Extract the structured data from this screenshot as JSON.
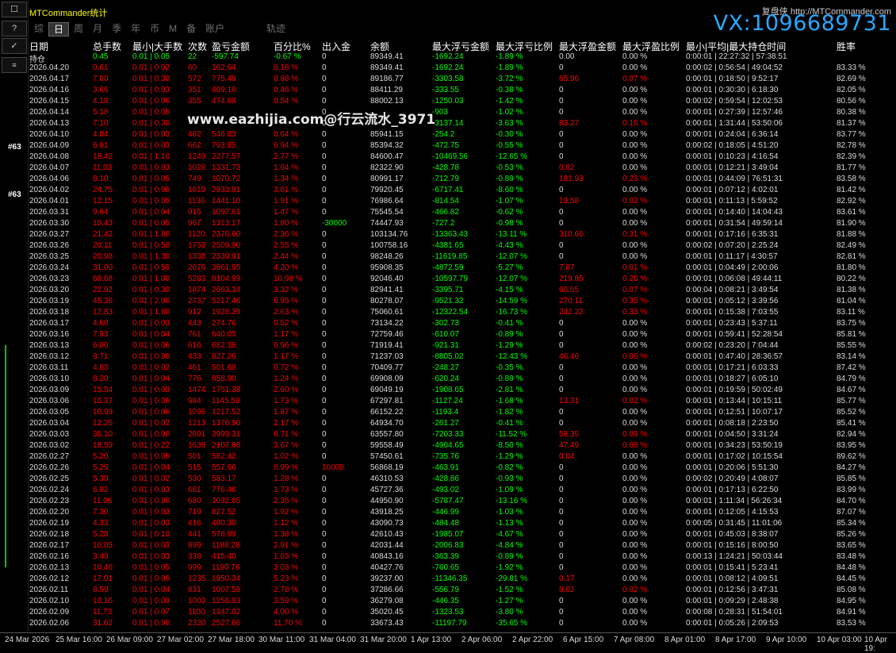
{
  "app": {
    "title": "MTCommander统计",
    "brand": "复盘侠 http://MTCommander.com",
    "vx": "VX:1096689731"
  },
  "watermark": "www.eazhijia.com@行云流水_3971",
  "tabs": [
    "综",
    "日",
    "周",
    "月",
    "季",
    "年",
    "币",
    "M",
    "备",
    "账户"
  ],
  "active_tab": "日",
  "track_tab": "轨迹",
  "left_toolbar": {
    "items": [
      "☐",
      "?",
      "✓"
    ],
    "marker": "#63"
  },
  "headers": [
    "日期",
    "总手数",
    "最小|大手数",
    "次数",
    "盈亏金额",
    "百分比%",
    "出入金",
    "余额",
    "最大浮亏金额",
    "最大浮亏比例",
    "最大浮盈金额",
    "最大浮盈比例",
    "最小|平均|最大持仓时间",
    "胜率"
  ],
  "holding": {
    "date": "持仓",
    "lots": "0.45",
    "minmax": "0.01 | 0.05",
    "count": "22",
    "pnl": "-597.74",
    "pct": "-0.67 %",
    "io": "0",
    "balance": "89349.41",
    "maxloss": "-1692.24",
    "maxlosspct": "-1.89 %",
    "maxprofit": "0.00",
    "maxprofitpct": "0.00 %",
    "time": "0:00:01 | 22:27:32 | 57:38:51",
    "win": ""
  },
  "rows": [
    [
      "2026.04.20",
      "0.61",
      "0.01 | 0.02",
      "60",
      "162.64",
      "0.18 %",
      "0",
      "89349.41",
      "-1692.24",
      "-1.89 %",
      "0",
      "0.00 %",
      "0:00:02 | 0:56:54 | 49:04:52",
      "83.33 %"
    ],
    [
      "2026.04.17",
      "7.00",
      "0.01 | 0.30",
      "572",
      "775.48",
      "0.88 %",
      "0",
      "89186.77",
      "-3303.58",
      "-3.72 %",
      "65.96",
      "0.07 %",
      "0:00:01 | 0:18:50 | 9:52:17",
      "82.69 %"
    ],
    [
      "2026.04.16",
      "3.66",
      "0.01 | 0.03",
      "351",
      "409.16",
      "0.46 %",
      "0",
      "88411.29",
      "-333.55",
      "-0.38 %",
      "0",
      "0.00 %",
      "0:00:01 | 0:30:30 | 6:18:30",
      "82.05 %"
    ],
    [
      "2026.04.15",
      "4.18",
      "0.01 | 0.06",
      "355",
      "474.68",
      "0.54 %",
      "0",
      "88002.13",
      "-1250.03",
      "-1.42 %",
      "0",
      "0.00 %",
      "0:00:02 | 0:59:54 | 12:02:53",
      "80.56 %"
    ],
    [
      "2026.04.14",
      "5.18",
      "0.01 | 0.05",
      "",
      "",
      "",
      "0",
      "",
      "-903",
      "-1.02 %",
      "0",
      "0.00 %",
      "0:00:01 | 0:27:39 | 12:57:46",
      "80.38 %"
    ],
    [
      "2026.04.13",
      "7.10",
      "0.01 | 0.30",
      "",
      "",
      "",
      "0",
      "",
      "-3137.14",
      "-3.63 %",
      "83.27",
      "0.10 %",
      "0:00:01 | 1:31:44 | 53:50:06",
      "81.37 %"
    ],
    [
      "2026.04.10",
      "4.84",
      "0.01 | 0.03",
      "462",
      "546.83",
      "0.64 %",
      "0",
      "85941.15",
      "-254.2",
      "-0.30 %",
      "0",
      "0.00 %",
      "0:00:01 | 0:24:04 | 6:36:14",
      "83.77 %"
    ],
    [
      "2026.04.09",
      "6.91",
      "0.01 | 0.03",
      "662",
      "793.85",
      "0.94 %",
      "0",
      "85394.32",
      "-472.75",
      "-0.55 %",
      "0",
      "0.00 %",
      "0:00:02 | 0:18:05 | 4:51:20",
      "82.78 %"
    ],
    [
      "2026.04.08",
      "18.42",
      "0.01 | 1.10",
      "1249",
      "2277.57",
      "2.77 %",
      "0",
      "84600.47",
      "-10469.56",
      "-12.65 %",
      "0",
      "0.00 %",
      "0:00:01 | 0:10:23 | 4:16:54",
      "82.39 %"
    ],
    [
      "2026.04.07",
      "11.03",
      "0.01 | 0.03",
      "1026",
      "1331.73",
      "1.64 %",
      "0",
      "82322.90",
      "-428.78",
      "-0.53 %",
      "0.82",
      "0.00 %",
      "0:00:01 | 0:12:21 | 3:49:04",
      "81.77 %"
    ],
    [
      "2026.04.06",
      "8.10",
      "0.01 | 0.05",
      "749",
      "1070.72",
      "1.34 %",
      "0",
      "80991.17",
      "-712.79",
      "-0.89 %",
      "181.93",
      "0.23 %",
      "0:00:01 | 0:44:09 | 76:51:31",
      "83.58 %"
    ],
    [
      "2026.04.02",
      "24.75",
      "0.01 | 0.90",
      "1819",
      "2933.81",
      "3.81 %",
      "0",
      "79920.45",
      "-6717.41",
      "-8.60 %",
      "0",
      "0.00 %",
      "0:00:01 | 0:07:12 | 4:02:01",
      "81.42 %"
    ],
    [
      "2026.04.01",
      "12.15",
      "0.01 | 0.05",
      "1136",
      "1441.10",
      "1.91 %",
      "0",
      "76986.64",
      "-814.54",
      "-1.07 %",
      "19.58",
      "0.03 %",
      "0:00:01 | 0:11:13 | 5:59:52",
      "82.92 %"
    ],
    [
      "2026.03.31",
      "9.64",
      "0.01 | 0.04",
      "915",
      "1097.61",
      "1.47 %",
      "0",
      "75545.54",
      "-466.82",
      "-0.62 %",
      "0",
      "0.00 %",
      "0:00:01 | 0:14:40 | 14:04:43",
      "83.61 %"
    ],
    [
      "2026.03.30",
      "10.43",
      "0.01 | 0.05",
      "967",
      "1313.17",
      "1.80 %",
      "-30000",
      "74447.93",
      "-727.2",
      "-0.98 %",
      "0",
      "0.00 %",
      "0:00:01 | 0:31:54 | 49:59:14",
      "81.90 %"
    ],
    [
      "2026.03.27",
      "21.42",
      "0.01 | 1.80",
      "1120",
      "2376.60",
      "2.36 %",
      "0",
      "103134.76",
      "-13363.43",
      "-13.11 %",
      "310.66",
      "0.31 %",
      "0:00:01 | 0:17:16 | 6:35:31",
      "81.88 %"
    ],
    [
      "2026.03.26",
      "20.11",
      "0.01 | 0.50",
      "1759",
      "2509.90",
      "2.55 %",
      "0",
      "100758.16",
      "-4381.65",
      "-4.43 %",
      "0",
      "0.00 %",
      "0:00:02 | 0:07:20 | 2:25:24",
      "82.49 %"
    ],
    [
      "2026.03.25",
      "20.98",
      "0.01 | 1.30",
      "1338",
      "2339.91",
      "2.44 %",
      "0",
      "98248.26",
      "-11619.85",
      "-12.07 %",
      "0",
      "0.00 %",
      "0:00:01 | 0:11:17 | 4:30:57",
      "82.81 %"
    ],
    [
      "2026.03.24",
      "31.00",
      "0.01 | 0.50",
      "2676",
      "3861.95",
      "4.20 %",
      "0",
      "95908.35",
      "-4872.59",
      "-5.27 %",
      "7.87",
      "0.01 %",
      "0:00:01 | 0:04:49 | 2:00:06",
      "81.80 %"
    ],
    [
      "2026.03.23",
      "68.68",
      "0.01 | 1.00",
      "5283",
      "8104.99",
      "10.98 %",
      "0",
      "92046.40",
      "-10597.79",
      "-12.07 %",
      "219.85",
      "0.26 %",
      "0:00:01 | 0:06:08 | 49:44:11",
      "80.22 %"
    ],
    [
      "2026.03.20",
      "22.92",
      "0.01 | 0.30",
      "1874",
      "2663.34",
      "3.32 %",
      "0",
      "82941.41",
      "-3395.71",
      "-4.15 %",
      "60.55",
      "0.07 %",
      "0:00:04 | 0:08:21 | 3:49:54",
      "81.38 %"
    ],
    [
      "2026.03.19",
      "45.36",
      "0.01 | 2.00",
      "2737",
      "5217.46",
      "6.95 %",
      "0",
      "80278.07",
      "-9521.32",
      "-14.59 %",
      "270.11",
      "0.35 %",
      "0:00:01 | 0:05:12 | 3:39:56",
      "81.04 %"
    ],
    [
      "2026.03.18",
      "17.83",
      "0.01 | 1.80",
      "912",
      "1926.39",
      "2.63 %",
      "0",
      "75060.61",
      "-12322.54",
      "-16.73 %",
      "242.22",
      "0.33 %",
      "0:00:01 | 0:15:38 | 7:03:55",
      "83.11 %"
    ],
    [
      "2026.03.17",
      "4.60",
      "0.01 | 0.03",
      "443",
      "274.76",
      "0.52 %",
      "0",
      "73134.22",
      "-302.73",
      "-0.41 %",
      "0",
      "0.00 %",
      "0:00:01 | 0:23:43 | 5:37:11",
      "83.75 %"
    ],
    [
      "2026.03.16",
      "7.93",
      "0.01 | 0.04",
      "761",
      "640.05",
      "1.17 %",
      "0",
      "72759.46",
      "-610.07",
      "-0.89 %",
      "0",
      "0.00 %",
      "0:00:01 | 0:59:41 | 52:28:54",
      "85.81 %"
    ],
    [
      "2026.03.13",
      "6.80",
      "0.01 | 0.06",
      "616",
      "682.38",
      "0.96 %",
      "0",
      "71919.41",
      "-921.31",
      "-1.29 %",
      "0",
      "0.00 %",
      "0:00:02 | 0:23:20 | 7:04:44",
      "85.55 %"
    ],
    [
      "2026.03.12",
      "8.71",
      "0.01 | 0.90",
      "433",
      "827.26",
      "1.17 %",
      "0",
      "71237.03",
      "-8805.02",
      "-12.43 %",
      "40.46",
      "0.06 %",
      "0:00:01 | 0:47:40 | 28:36:57",
      "83.14 %"
    ],
    [
      "2026.03.11",
      "4.83",
      "0.01 | 0.02",
      "461",
      "501.68",
      "0.72 %",
      "0",
      "70409.77",
      "-248.27",
      "-0.35 %",
      "0",
      "0.00 %",
      "0:00:01 | 0:17:21 | 6:03:33",
      "87.42 %"
    ],
    [
      "2026.03.10",
      "8.20",
      "0.01 | 0.04",
      "776",
      "858.90",
      "1.24 %",
      "0",
      "69908.09",
      "-620.24",
      "-0.89 %",
      "0",
      "0.00 %",
      "0:00:01 | 0:18:27 | 6:05:10",
      "84.79 %"
    ],
    [
      "2026.03.09",
      "15.54",
      "0.01 | 0.09",
      "1474",
      "1751.38",
      "2.60 %",
      "0",
      "69049.19",
      "-1908.65",
      "-2.81 %",
      "0",
      "0.00 %",
      "0:00:01 | 0:19:59 | 50:02:49",
      "84.67 %"
    ],
    [
      "2026.03.06",
      "10.37",
      "0.01 | 0.06",
      "984",
      "1145.59",
      "1.73 %",
      "0",
      "67297.81",
      "-1127.24",
      "-1.68 %",
      "13.31",
      "0.02 %",
      "0:00:01 | 0:13:44 | 10:15:11",
      "85.77 %"
    ],
    [
      "2026.03.05",
      "10.99",
      "0.01 | 0.06",
      "1036",
      "1217.52",
      "1.87 %",
      "0",
      "66152.22",
      "-1193.4",
      "-1.82 %",
      "0",
      "0.00 %",
      "0:00:01 | 0:12:51 | 10:07:17",
      "85.52 %"
    ],
    [
      "2026.03.04",
      "12.25",
      "0.01 | 0.02",
      "1213",
      "1376.90",
      "2.17 %",
      "0",
      "64934.70",
      "-261.27",
      "-0.41 %",
      "0",
      "0.00 %",
      "0:00:01 | 0:08:18 | 2:23:50",
      "85.41 %"
    ],
    [
      "2026.03.03",
      "36.10",
      "0.01 | 0.90",
      "2691",
      "3999.31",
      "6.71 %",
      "0",
      "63557.80",
      "-7203.33",
      "-11.52 %",
      "58.35",
      "0.09 %",
      "0:00:01 | 0:04:50 | 3:31:24",
      "82.94 %"
    ],
    [
      "2026.03.02",
      "18.59",
      "0.01 | 0.22",
      "1639",
      "2107.88",
      "3.67 %",
      "0",
      "59558.49",
      "-4904.65",
      "-8.50 %",
      "47.49",
      "0.08 %",
      "0:00:01 | 0:34:23 | 53:50:19",
      "83.95 %"
    ],
    [
      "2026.02.27",
      "5.20",
      "0.01 | 0.05",
      "501",
      "582.42",
      "1.02 %",
      "0",
      "57450.61",
      "-735.76",
      "-1.29 %",
      "0.04",
      "0.00 %",
      "0:00:01 | 0:17:02 | 10:15:54",
      "89.62 %"
    ],
    [
      "2026.02.26",
      "5.29",
      "0.01 | 0.04",
      "515",
      "557.66",
      "0.99 %",
      "10000",
      "56868.19",
      "-463.91",
      "-0.82 %",
      "0",
      "0.00 %",
      "0:00:01 | 0:20:06 | 5:51:30",
      "84.27 %"
    ],
    [
      "2026.02.25",
      "5.39",
      "0.01 | 0.02",
      "530",
      "583.17",
      "1.28 %",
      "0",
      "46310.53",
      "-428.86",
      "-0.93 %",
      "0",
      "0.00 %",
      "0:00:02 | 0:20:49 | 4:08:07",
      "85.85 %"
    ],
    [
      "2026.02.24",
      "6.92",
      "0.01 | 0.03",
      "681",
      "776.46",
      "1.73 %",
      "0",
      "45727.36",
      "-493.02",
      "-1.09 %",
      "0",
      "0.00 %",
      "0:00:01 | 0:17:13 | 6:22:50",
      "83.99 %"
    ],
    [
      "2026.02.23",
      "11.06",
      "0.01 | 0.90",
      "680",
      "1032.65",
      "2.35 %",
      "0",
      "44950.90",
      "-5787.47",
      "-13.16 %",
      "0",
      "0.00 %",
      "0:00:01 | 1:11:34 | 56:26:34",
      "84.70 %"
    ],
    [
      "2026.02.20",
      "7.30",
      "0.01 | 0.03",
      "719",
      "827.52",
      "1.92 %",
      "0",
      "43918.25",
      "-446.99",
      "-1.03 %",
      "0",
      "0.00 %",
      "0:00:01 | 0:12:05 | 4:15:53",
      "87.07 %"
    ],
    [
      "2026.02.19",
      "4.33",
      "0.01 | 0.03",
      "416",
      "480.30",
      "1.12 %",
      "0",
      "43090.73",
      "-484.48",
      "-1.13 %",
      "0",
      "0.00 %",
      "0:00:05 | 0:31:45 | 11:01:06",
      "85.34 %"
    ],
    [
      "2026.02.18",
      "5.28",
      "0.01 | 0.10",
      "441",
      "578.99",
      "1.38 %",
      "0",
      "42610.43",
      "-1985.07",
      "-4.67 %",
      "0",
      "0.00 %",
      "0:00:01 | 0:45:03 | 8:38:07",
      "85.26 %"
    ],
    [
      "2026.02.17",
      "10.05",
      "0.01 | 0.03",
      "899",
      "1188.28",
      "2.91 %",
      "0",
      "42031.44",
      "-2006.83",
      "-4.84 %",
      "0",
      "0.00 %",
      "0:00:01 | 0:15:16 | 8:00:50",
      "83.65 %"
    ],
    [
      "2026.02.16",
      "3.49",
      "0.01 | 0.03",
      "339",
      "415.40",
      "1.03 %",
      "0",
      "40843.16",
      "-363.39",
      "-0.89 %",
      "0",
      "0.00 %",
      "0:00:13 | 1:24:21 | 50:03:44",
      "83.48 %"
    ],
    [
      "2026.02.13",
      "10.46",
      "0.01 | 0.05",
      "999",
      "1190.76",
      "3.03 %",
      "0",
      "40427.76",
      "-760.65",
      "-1.92 %",
      "0",
      "0.00 %",
      "0:00:01 | 0:15:41 | 5:23:41",
      "84.48 %"
    ],
    [
      "2026.02.12",
      "17.01",
      "0.01 | 0.90",
      "1235",
      "1950.34",
      "5.23 %",
      "0",
      "39237.00",
      "-11346.35",
      "-29.81 %",
      "0.17",
      "0.00 %",
      "0:00:01 | 0:08:12 | 4:09:51",
      "84.45 %"
    ],
    [
      "2026.02.11",
      "8.59",
      "0.01 | 0.04",
      "831",
      "1007.58",
      "2.78 %",
      "0",
      "37286.66",
      "-556.79",
      "-1.52 %",
      "8.02",
      "0.02 %",
      "0:00:01 | 0:12:56 | 3:47:31",
      "85.08 %"
    ],
    [
      "2026.02.10",
      "10.16",
      "0.01 | 0.03",
      "1003",
      "1256.83",
      "3.59 %",
      "0",
      "36279.08",
      "-446.35",
      "-1.27 %",
      "0",
      "0.00 %",
      "0:00:01 | 0:09:29 | 2:48:38",
      "84.95 %"
    ],
    [
      "2026.02.09",
      "11.73",
      "0.01 | 0.07",
      "1100",
      "1347.02",
      "4.00 %",
      "0",
      "35020.45",
      "-1323.53",
      "-3.80 %",
      "0",
      "0.00 %",
      "0:00:08 | 0:28:31 | 51:54:01",
      "84.91 %"
    ],
    [
      "2026.02.06",
      "31.62",
      "0.01 | 0.90",
      "2320",
      "2527.66",
      "11.70 %",
      "0",
      "33673.43",
      "-11197.79",
      "-35.65 %",
      "0",
      "0.00 %",
      "0:00:01 | 0:05:26 | 2:09:53",
      "83.53 %"
    ]
  ],
  "xaxis": [
    "24 Mar 2026",
    "25 Mar 16:00",
    "26 Mar 09:00",
    "27 Mar 02:00",
    "27 Mar 18:00",
    "30 Mar 11:00",
    "31 Mar 04:00",
    "31 Mar 20:00",
    "1 Apr 13:00",
    "2 Apr 06:00",
    "2 Apr 22:00",
    "6 Apr 15:00",
    "7 Apr 08:00",
    "8 Apr 01:00",
    "8 Apr 17:00",
    "9 Apr 10:00",
    "10 Apr 03:00",
    "10 Apr 19:"
  ],
  "colors": {
    "profit": "#ff0000",
    "loss": "#00ff00",
    "neutral": "#dcdcdc",
    "accent": "#ffff00",
    "vx": "#29a8ff"
  }
}
